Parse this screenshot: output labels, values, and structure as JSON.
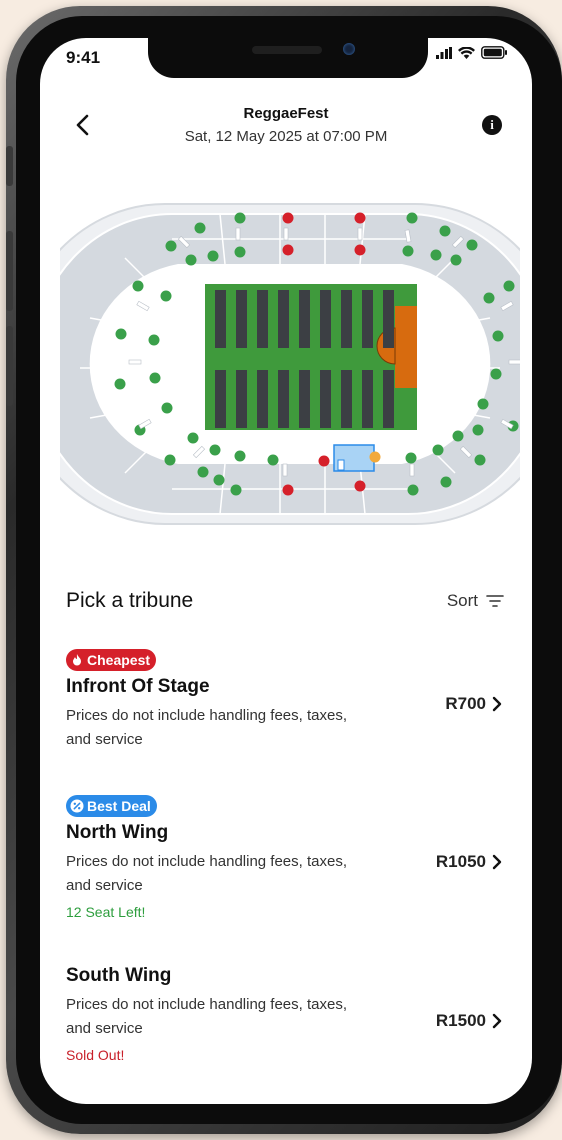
{
  "status_bar": {
    "time": "9:41"
  },
  "header": {
    "title": "ReggaeFest",
    "subtitle": "Sat, 12 May 2025 at 07:00 PM"
  },
  "seat_map": {
    "colors": {
      "available": "#3aa04a",
      "sold": "#d5202a",
      "selected": "#f2a93b",
      "field": "#3f9a3c",
      "stage": "#d76b0f"
    }
  },
  "tribune_list": {
    "title": "Pick a tribune",
    "sort_label": "Sort",
    "items": [
      {
        "badge": "Cheapest",
        "badge_color": "#d5202a",
        "badge_icon": "fire-icon",
        "name": "Infront Of Stage",
        "description": "Prices do not include handling fees, taxes, and service",
        "price": "R700",
        "note": ""
      },
      {
        "badge": "Best Deal",
        "badge_color": "#2b8be8",
        "badge_icon": "percent-icon",
        "name": "North Wing",
        "description": "Prices do not include handling fees, taxes, and service",
        "price": "R1050",
        "note": "12 Seat Left!",
        "note_color": "#2e9e3e"
      },
      {
        "badge": "",
        "name": "South Wing",
        "description": "Prices do not include handling fees, taxes, and service",
        "price": "R1500",
        "note": "Sold Out!",
        "note_color": "#c8202a"
      }
    ]
  }
}
